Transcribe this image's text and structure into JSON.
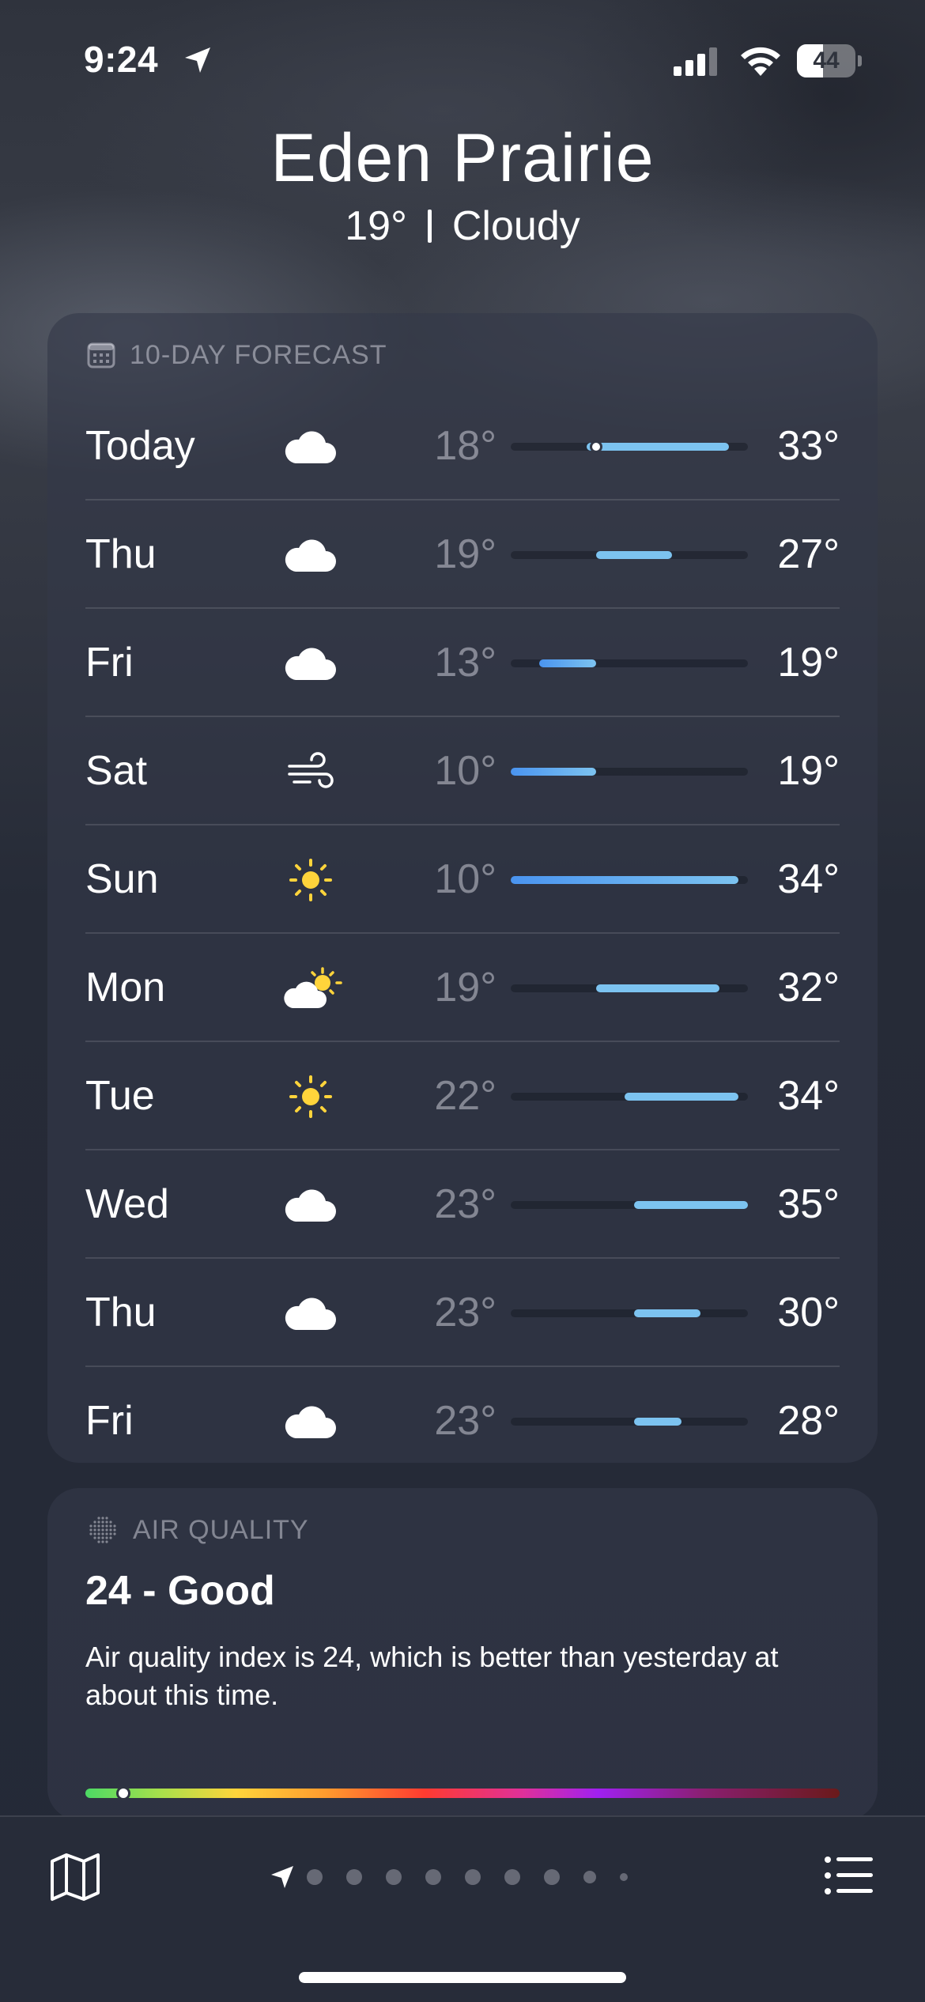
{
  "status_bar": {
    "time": "9:24",
    "battery_level": "44",
    "battery_fraction": 0.44
  },
  "location": {
    "city": "Eden Prairie",
    "current_temp": "19°",
    "condition": "Cloudy"
  },
  "forecast": {
    "label": "10-DAY FORECAST",
    "scale_min": 10,
    "scale_max": 35,
    "current_value": 19,
    "days": [
      {
        "day": "Today",
        "icon": "cloud-icon",
        "low": "18°",
        "high": "33°",
        "low_v": 18,
        "high_v": 33,
        "show_current": true
      },
      {
        "day": "Thu",
        "icon": "cloud-icon",
        "low": "19°",
        "high": "27°",
        "low_v": 19,
        "high_v": 27
      },
      {
        "day": "Fri",
        "icon": "cloud-icon",
        "low": "13°",
        "high": "19°",
        "low_v": 13,
        "high_v": 19
      },
      {
        "day": "Sat",
        "icon": "wind-icon",
        "low": "10°",
        "high": "19°",
        "low_v": 10,
        "high_v": 19
      },
      {
        "day": "Sun",
        "icon": "sun-icon",
        "low": "10°",
        "high": "34°",
        "low_v": 10,
        "high_v": 34
      },
      {
        "day": "Mon",
        "icon": "partly-sunny-icon",
        "low": "19°",
        "high": "32°",
        "low_v": 19,
        "high_v": 32
      },
      {
        "day": "Tue",
        "icon": "sun-icon",
        "low": "22°",
        "high": "34°",
        "low_v": 22,
        "high_v": 34
      },
      {
        "day": "Wed",
        "icon": "cloud-icon",
        "low": "23°",
        "high": "35°",
        "low_v": 23,
        "high_v": 35
      },
      {
        "day": "Thu",
        "icon": "cloud-icon",
        "low": "23°",
        "high": "30°",
        "low_v": 23,
        "high_v": 30
      },
      {
        "day": "Fri",
        "icon": "cloud-icon",
        "low": "23°",
        "high": "28°",
        "low_v": 23,
        "high_v": 28
      }
    ]
  },
  "air_quality": {
    "label": "AIR QUALITY",
    "value": "24 - Good",
    "description": "Air quality index is 24, which is better than yesterday at about this time.",
    "scale_fraction": 0.05
  },
  "colors": {
    "cool_bar": "#4a94f0",
    "warm_bar": "#7cc3f0",
    "sun": "#ffd43b"
  }
}
